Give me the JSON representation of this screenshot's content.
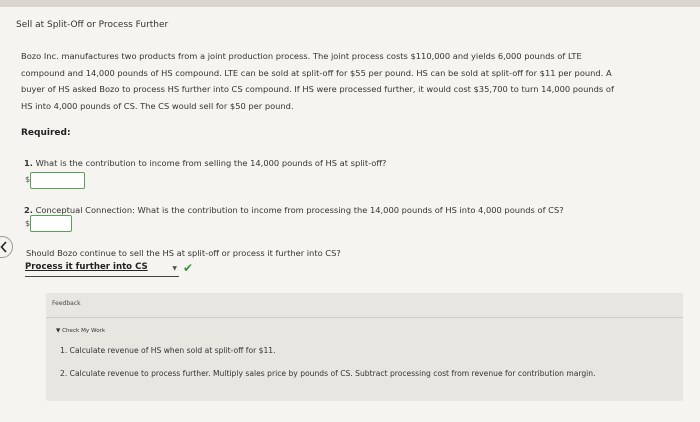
{
  "title": "Sell at Split-Off or Process Further",
  "problem": {
    "line1": "Bozo Inc. manufactures two products from a joint production process. The joint process costs $110,000 and yields 6,000 pounds of LTE",
    "line2": "compound and 14,000 pounds of HS compound. LTE can be sold at split-off for $55 per pound. HS can be sold at split-off for $11 per pound. A",
    "line3": "buyer of HS asked Bozo to process HS further into CS compound. If HS were processed further, it would cost $35,700 to turn 14,000 pounds of",
    "line4": "HS into 4,000 pounds of CS. The CS would sell for $50 per pound."
  },
  "required_label": "Required:",
  "q1": {
    "num": "1.",
    "text": "What is the contribution to income from selling the 14,000 pounds of HS at split-off?",
    "currency": "$",
    "value": ""
  },
  "q2": {
    "num": "2.",
    "text": "Conceptual Connection: What is the contribution to income from processing the 14,000 pounds of HS into 4,000 pounds of CS?",
    "currency": "$",
    "value": ""
  },
  "q3": {
    "text": "Should Bozo continue to sell the HS at split-off or process it further into CS?",
    "selected": "Process it further into CS"
  },
  "feedback": {
    "label": "Feedback",
    "toggle": "Check My Work",
    "hint1": "1. Calculate revenue of HS when sold at split-off for $11.",
    "hint2": "2. Calculate revenue to process further. Multiply sales price by pounds of CS. Subtract processing cost from revenue for contribution margin."
  },
  "colors": {
    "input_border": "#5aa05a",
    "check": "#3f8f3f",
    "feedback_bg": "#e7e6e1"
  },
  "icons": {
    "prev": "chevron-left-icon",
    "dropdown": "chevron-down-icon",
    "correct": "checkmark-icon",
    "toggle": "triangle-down-icon"
  }
}
